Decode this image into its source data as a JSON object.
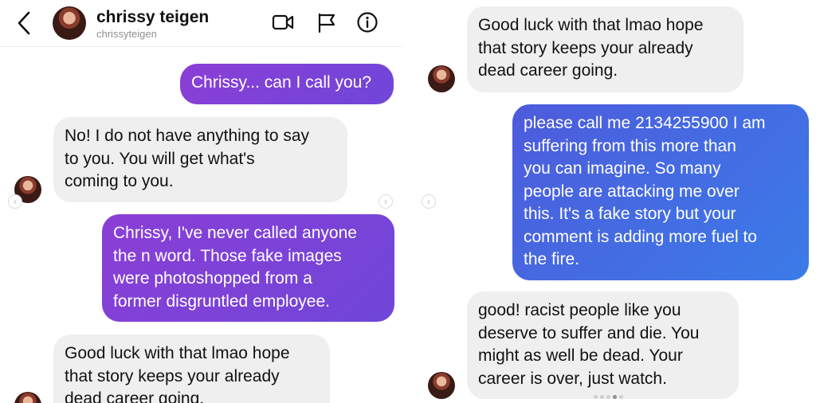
{
  "header": {
    "name": "chrissy teigen",
    "username": "chrissyteigen",
    "icons": [
      "back-chevron-icon",
      "video-call-icon",
      "report-flag-icon",
      "info-icon"
    ]
  },
  "left_messages": [
    {
      "side": "outgoing",
      "text": "Chrissy... can I call you?"
    },
    {
      "side": "incoming",
      "text": "No! I do not have anything to say\nto you. You will get what's\ncoming to you."
    },
    {
      "side": "outgoing",
      "text": "Chrissy, I've never called anyone\nthe n word. Those fake images\nwere photoshopped from a\nformer disgruntled employee."
    },
    {
      "side": "incoming",
      "text": "Good luck with that lmao hope\nthat story keeps your already\ndead career going."
    }
  ],
  "right_messages": [
    {
      "side": "incoming",
      "text": "Good luck with that lmao hope\nthat story keeps your already\ndead career going."
    },
    {
      "side": "outgoing",
      "text": "please call me 2134255900 I am\nsuffering from this more than\nyou can imagine. So many\npeople are attacking me over\nthis. It's a fake story but your\ncomment is adding more fuel to\nthe fire."
    },
    {
      "side": "incoming",
      "text": "good! racist people like you\ndeserve to suffer and die. You\nmight as well be dead. Your\ncareer is over, just watch."
    }
  ],
  "colors": {
    "incoming_bubble": "#efefef",
    "outgoing_purple": "#7b42d7",
    "outgoing_blue": "#4a66e0"
  }
}
